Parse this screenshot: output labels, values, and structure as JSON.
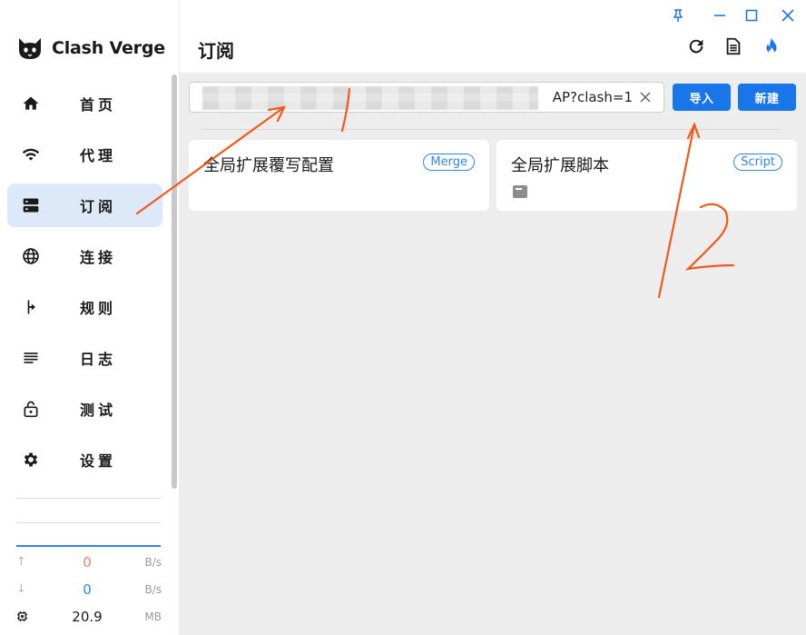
{
  "app": {
    "name": "Clash Verge"
  },
  "sidebar": {
    "items": [
      {
        "label": "首页",
        "icon": "home-icon"
      },
      {
        "label": "代理",
        "icon": "wifi-icon"
      },
      {
        "label": "订阅",
        "icon": "subscription-icon",
        "active": true
      },
      {
        "label": "连接",
        "icon": "globe-icon"
      },
      {
        "label": "规则",
        "icon": "fork-icon"
      },
      {
        "label": "日志",
        "icon": "log-icon"
      },
      {
        "label": "测试",
        "icon": "lock-icon"
      },
      {
        "label": "设置",
        "icon": "gear-icon"
      }
    ],
    "traffic": {
      "upload_value": "0",
      "upload_unit": "B/s",
      "download_value": "0",
      "download_unit": "B/s",
      "memory_value": "20.9",
      "memory_unit": "MB"
    }
  },
  "header": {
    "title": "订阅"
  },
  "import_bar": {
    "url_value": "AP?clash=1",
    "import_label": "导入",
    "new_label": "新建"
  },
  "cards": [
    {
      "title": "全局扩展覆写配置",
      "badge": "Merge"
    },
    {
      "title": "全局扩展脚本",
      "badge": "Script"
    }
  ],
  "annotation": {
    "number": "2"
  },
  "colors": {
    "accent": "#1976e8",
    "active_bg": "#dde9f8",
    "upload": "#f0806a",
    "download": "#2f86e8",
    "annotation": "#f05a1a"
  }
}
